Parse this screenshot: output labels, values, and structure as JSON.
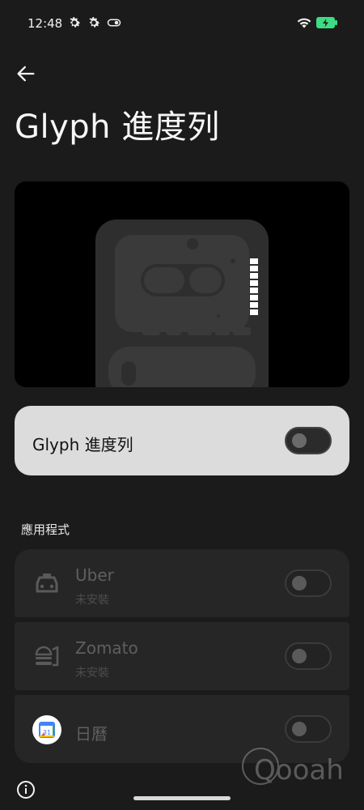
{
  "status_bar": {
    "time": "12:48",
    "icons": [
      "gear-icon",
      "gear-icon",
      "toggle-icon",
      "wifi-icon",
      "battery-charging-icon"
    ],
    "battery_color": "#3ddc84"
  },
  "header": {
    "back_icon": "arrow-left-icon",
    "title": "Glyph 進度列"
  },
  "preview": {
    "description_icon": "phone-glyph-preview",
    "progress_segments": 8,
    "progress_filled": 8
  },
  "main_toggle": {
    "label": "Glyph 進度列",
    "enabled": false
  },
  "apps_section": {
    "title": "應用程式",
    "items": [
      {
        "name": "Uber",
        "status": "未安裝",
        "icon": "car-icon",
        "enabled": false
      },
      {
        "name": "Zomato",
        "status": "未安裝",
        "icon": "food-delivery-icon",
        "enabled": false
      },
      {
        "name": "日曆",
        "status": "",
        "icon": "calendar-icon",
        "icon_label": "31",
        "enabled": false
      }
    ]
  },
  "footer": {
    "info_icon": "info-icon",
    "watermark": "Qooah"
  },
  "colors": {
    "background": "#1b1b1b",
    "card_light": "#dcdcdc",
    "card_dark": "#262626",
    "calendar_blue": "#4285f4"
  }
}
